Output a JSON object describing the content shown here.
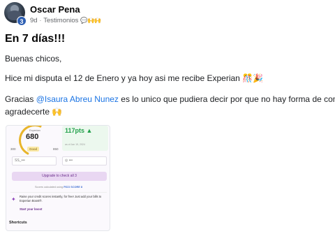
{
  "post": {
    "author": "Oscar Pena",
    "avatar_badge": "3",
    "time": "9d",
    "separator": "·",
    "group": "Testimonios",
    "group_emojis": "💬🙌🙌",
    "title": "En 7 días!!!",
    "line1": "Buenas chicos,",
    "line2": "Hice mi disputa el 12 de Enero y ya hoy asi me recibe Experian 🎊🎉",
    "line3_pre": "Gracias ",
    "mention": "@Isaura Abreu Nunez",
    "line3_post": " es lo unico que pudiera decir por que no hay forma de como",
    "line4": "agradecerte 🙌"
  },
  "screenshot": {
    "gauge_label": "Experian",
    "score": "680",
    "range_low": "300",
    "rating": "Good",
    "range_high": "850",
    "points": "117pts ▲",
    "points_sub": "as of Jan 19, 2024",
    "field1": "SS_•••",
    "field2": "◎ •••",
    "upgrade": "Upgrade to check all 3",
    "calc_pre": "Scores calculated using",
    "calc_brand": "FICO SCORE 8",
    "boost_text": "Raise your credit scores instantly, for free! Just add your bills to Experian Boost®.",
    "boost_link": "Start your boost",
    "boost_icon": "✦",
    "shortcuts": "Shortcuts"
  },
  "colors": {
    "mention": "#1b74e4",
    "points_green": "#21a04a",
    "badge_blue": "#2d5fb3",
    "upgrade_purple": "#e9d7f2"
  }
}
